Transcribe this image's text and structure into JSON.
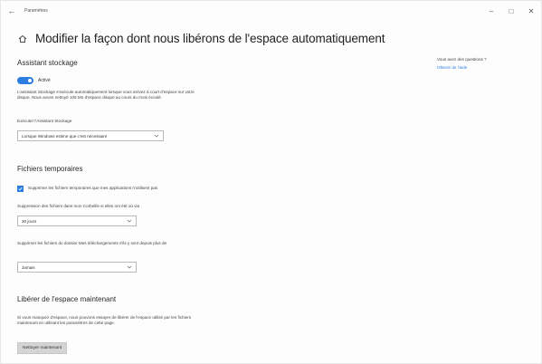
{
  "window": {
    "title": "Paramètres",
    "back_glyph": "←",
    "minimize_glyph": "–",
    "maximize_glyph": "□",
    "close_glyph": "✕"
  },
  "header": {
    "title": "Modifier la façon dont nous libérons de l'espace automatiquement"
  },
  "storage_sense": {
    "section_title": "Assistant stockage",
    "toggle_label": "Activé",
    "toggle_on": true,
    "description": "L'assistant Stockage s'exécute automatiquement lorsque vous arrivez à court d'espace sur votre disque. Nous avons nettoyé 105 Mo d'espace disque au cours du mois écoulé.",
    "run_label": "Exécuter l'Assistant Stockage",
    "run_value": "Lorsque Windows estime que c'est nécessaire"
  },
  "temp_files": {
    "section_title": "Fichiers temporaires",
    "checkbox_checked": true,
    "checkbox_label": "Supprimer les fichiers temporaires que mes applications n'utilisent pas",
    "recycle_label": "Suppression des fichiers dans mon Corbeille si elles ont été où via",
    "recycle_value": "30 jours",
    "downloads_label": "Supprimer les fichiers du dossier Mes téléchargements s'ils y sont depuis plus de",
    "downloads_value": "Jamais"
  },
  "free_now": {
    "section_title": "Libérer de l'espace maintenant",
    "description": "Si vous manquez d'espace, nous pouvons essayer de libérer de l'espace utilisé par les fichiers maintenant en utilisant les paramètres de cette page.",
    "button_label": "Nettoyer maintenant"
  },
  "help": {
    "question": "Vous avez des questions ?",
    "link": "Obtenir de l'aide"
  },
  "colors": {
    "accent": "#2b7de0"
  }
}
